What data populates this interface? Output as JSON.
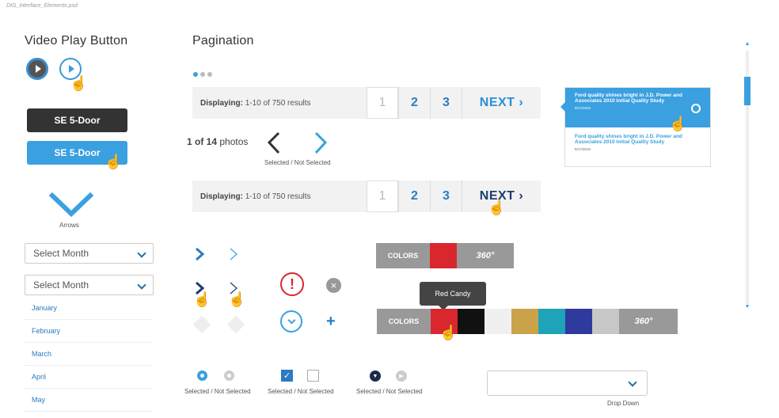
{
  "file_label": "DIG_Interface_Elements.psd",
  "sections": {
    "video_title": "Video Play Button",
    "pagination_title": "Pagination"
  },
  "buttons": {
    "dark_label": "SE 5-Door",
    "blue_label": "SE 5-Door"
  },
  "arrows_caption": "Arrows",
  "selects": {
    "first_value": "Select Month",
    "second_value": "Select Month"
  },
  "months": [
    "January",
    "February",
    "March",
    "April",
    "May"
  ],
  "photo_counter": {
    "current": "1 of 14",
    "suffix": "photos",
    "caption": "Selected / Not Selected"
  },
  "pager1": {
    "display_label": "Displaying:",
    "display_value": "1-10 of 750 results",
    "pages": [
      "1",
      "2",
      "3"
    ],
    "next_label": "NEXT"
  },
  "pager2": {
    "display_label": "Displaying:",
    "display_value": "1-10 of 750 results",
    "pages": [
      "1",
      "2",
      "3"
    ],
    "next_label": "NEXT"
  },
  "articles": [
    {
      "headline": "Ford quality shines bright in J.D. Power and Associates 2010 Initial Quality Study",
      "date": "6/17/2010"
    },
    {
      "headline": "Ford quality shines bright in J.D. Power and Associates 2010 Initial Quality Study",
      "date": "6/17/2010"
    }
  ],
  "colors_bar1": {
    "label": "COLORS",
    "badge_360": "360°"
  },
  "colors_bar2": {
    "label": "COLORS",
    "tooltip": "Red Candy",
    "badge_360": "360°",
    "swatches": [
      "#d9272e",
      "#111111",
      "#f0f0f0",
      "#c9a24a",
      "#1ea3b8",
      "#2e3a9e",
      "#c7c7c7"
    ]
  },
  "captions": {
    "radio": "Selected / Not Selected",
    "checkbox": "Selected / Not Selected",
    "dark_radio": "Selected / Not Selected",
    "dropdown": "Drop Down"
  },
  "colors": {
    "accent": "#3aa0e0",
    "dark": "#333333",
    "link": "#2a7cc0"
  }
}
